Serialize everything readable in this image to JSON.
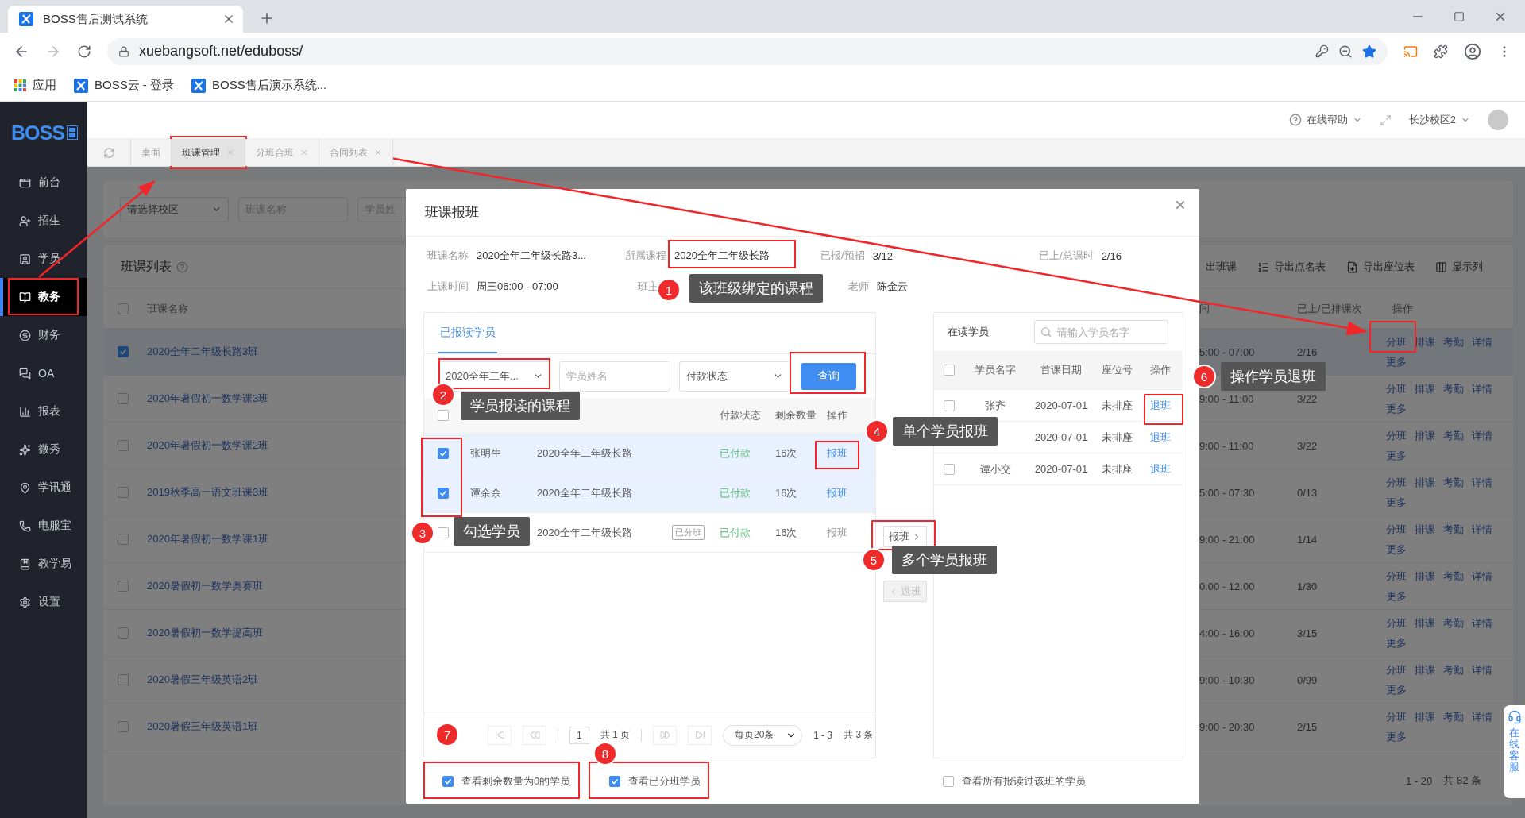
{
  "browser": {
    "tab_title": "BOSS售后测试系统",
    "url": "xuebangsoft.net/eduboss/",
    "bookmarks": [
      {
        "kind": "apps",
        "label": "应用"
      },
      {
        "kind": "site",
        "label": "BOSS云 - 登录"
      },
      {
        "kind": "site",
        "label": "BOSS售后演示系统..."
      }
    ]
  },
  "app": {
    "logo": "BOSS",
    "help": "在线帮助",
    "campus": "长沙校区2"
  },
  "sidebar": [
    {
      "label": "前台",
      "selected": false
    },
    {
      "label": "招生",
      "selected": false
    },
    {
      "label": "学员",
      "selected": false
    },
    {
      "label": "教务",
      "selected": true
    },
    {
      "label": "财务",
      "selected": false
    },
    {
      "label": "OA",
      "selected": false
    },
    {
      "label": "报表",
      "selected": false
    },
    {
      "label": "微秀",
      "selected": false
    },
    {
      "label": "学讯通",
      "selected": false
    },
    {
      "label": "电服宝",
      "selected": false
    },
    {
      "label": "教学易",
      "selected": false
    },
    {
      "label": "设置",
      "selected": false
    }
  ],
  "page_tabs": [
    {
      "label": "桌面",
      "selected": false,
      "closable": false
    },
    {
      "label": "班课管理",
      "selected": true,
      "closable": true
    },
    {
      "label": "分班合班",
      "selected": false,
      "closable": true
    },
    {
      "label": "合同列表",
      "selected": false,
      "closable": true
    }
  ],
  "filters": {
    "campus": "请选择校区",
    "class_name_placeholder": "班课名称",
    "student_name_placeholder": "学员姓"
  },
  "class_list": {
    "all_checked": false,
    "title": "班课列表",
    "toolbar": [
      "出班课",
      "导出点名表",
      "导出座位表",
      "显示列"
    ],
    "columns": [
      "班课名称",
      "间",
      "已上/已排课次",
      "操作"
    ],
    "rows": [
      {
        "checked": true,
        "name": "2020全年二年级长路3班",
        "time": "5:00 - 07:00",
        "count": "2/16",
        "actions": [
          "分班",
          "排课",
          "考勤",
          "详情",
          "更多"
        ]
      },
      {
        "checked": false,
        "name": "2020年暑假初一数学课3班",
        "time": "9:00 - 11:00",
        "count": "3/22",
        "actions": [
          "分班",
          "排课",
          "考勤",
          "详情",
          "更多"
        ]
      },
      {
        "checked": false,
        "name": "2020年暑假初一数学课2班",
        "time": "9:00 - 11:00",
        "count": "3/22",
        "actions": [
          "分班",
          "排课",
          "考勤",
          "详情",
          "更多"
        ]
      },
      {
        "checked": false,
        "name": "2019秋季高一语文班课3班",
        "time": "5:00 - 07:30",
        "count": "0/13",
        "actions": [
          "分班",
          "排课",
          "考勤",
          "详情",
          "更多"
        ]
      },
      {
        "checked": false,
        "name": "2020年暑假初一数学课1班",
        "time": "9:00 - 21:00",
        "count": "1/14",
        "actions": [
          "分班",
          "排课",
          "考勤",
          "详情",
          "更多"
        ]
      },
      {
        "checked": false,
        "name": "2020暑假初一数学奥赛班",
        "time": "0:00 - 12:00",
        "count": "1/30",
        "actions": [
          "分班",
          "排课",
          "考勤",
          "详情",
          "更多"
        ]
      },
      {
        "checked": false,
        "name": "2020暑假初一数学提高班",
        "time": "4:00 - 16:00",
        "count": "3/15",
        "actions": [
          "分班",
          "排课",
          "考勤",
          "详情",
          "更多"
        ]
      },
      {
        "checked": false,
        "name": "2020暑假三年级英语2班",
        "time": "9:00 - 10:30",
        "count": "0/99",
        "actions": [
          "分班",
          "排课",
          "考勤",
          "详情",
          "更多"
        ]
      },
      {
        "checked": false,
        "name": "2020暑假三年级英语1班",
        "time": "9:00 - 20:30",
        "count": "2/15",
        "actions": [
          "分班",
          "排课",
          "考勤",
          "详情",
          "更多"
        ]
      }
    ],
    "range": "1 - 20",
    "total": "共 82 条"
  },
  "modal": {
    "title": "班课报班",
    "info": [
      {
        "label": "班课名称",
        "value": "2020全年二年级长路3..."
      },
      {
        "label": "所属课程",
        "value": "2020全年二年级长路"
      },
      {
        "label": "已报/预招",
        "value": "3/12"
      },
      {
        "label": "已上/总课时",
        "value": "2/16"
      }
    ],
    "info_2": [
      {
        "label": "上课时间",
        "value": "周三06:00 - 07:00"
      },
      {
        "label": "班主"
      },
      {
        "label": "老师",
        "value": "陈金云"
      }
    ],
    "enrolled": {
      "all_checked": false,
      "tab": "已报读学员",
      "course_select": "2020全年二年...",
      "name_placeholder": "学员姓名",
      "payment_select": "付款状态",
      "query": "查询",
      "columns": [
        "付款状态",
        "剩余数量",
        "操作"
      ],
      "rows": [
        {
          "checked": true,
          "name": "张明生",
          "course": "2020全年二年级长路",
          "payment": "已付款",
          "remaining": "16次",
          "action": "报班",
          "disabled": false
        },
        {
          "checked": true,
          "name": "谭余余",
          "course": "2020全年二年级长路",
          "payment": "已付款",
          "remaining": "16次",
          "action": "报班",
          "disabled": false
        },
        {
          "checked": false,
          "course": "2020全年二年级长路",
          "tag": "已分班",
          "payment": "已付款",
          "remaining": "16次",
          "action": "报班",
          "disabled": true
        }
      ],
      "page": "1",
      "pages": "共 1 页",
      "per_page": "每页20条",
      "range": "1 - 3",
      "total": "共 3 条"
    },
    "transfer": [
      {
        "label": "报班",
        "kind": "forward",
        "disabled": false
      },
      {
        "label": "退班",
        "kind": "back",
        "disabled": true
      }
    ],
    "current": {
      "all_checked": false,
      "title": "在读学员",
      "search_placeholder": "请输入学员名字",
      "columns": [
        "学员名字",
        "首课日期",
        "座位号",
        "操作"
      ],
      "rows": [
        {
          "checked": false,
          "name": "张齐",
          "date": "2020-07-01",
          "seat": "未排座",
          "action": "退班"
        },
        {
          "date": "2020-07-01",
          "seat": "未排座",
          "action": "退班"
        },
        {
          "checked": false,
          "name": "谭小交",
          "date": "2020-07-01",
          "seat": "未排座",
          "action": "退班"
        }
      ]
    },
    "options": [
      {
        "label": "查看剩余数量为0的学员",
        "checked": true
      },
      {
        "label": "查看已分班学员",
        "checked": true
      },
      {
        "label": "查看所有报读过该班的学员",
        "checked": false
      }
    ]
  },
  "annotations": [
    {
      "number": "1",
      "text": "该班级绑定的课程"
    },
    {
      "number": "2",
      "text": "学员报读的课程"
    },
    {
      "number": "3",
      "text": "勾选学员"
    },
    {
      "number": "4",
      "text": "单个学员报班"
    },
    {
      "number": "5",
      "text": "多个学员报班"
    },
    {
      "number": "6",
      "text": "操作学员退班"
    },
    {
      "number": "7"
    },
    {
      "number": "8"
    }
  ],
  "chat": {
    "label": "在线客服"
  }
}
